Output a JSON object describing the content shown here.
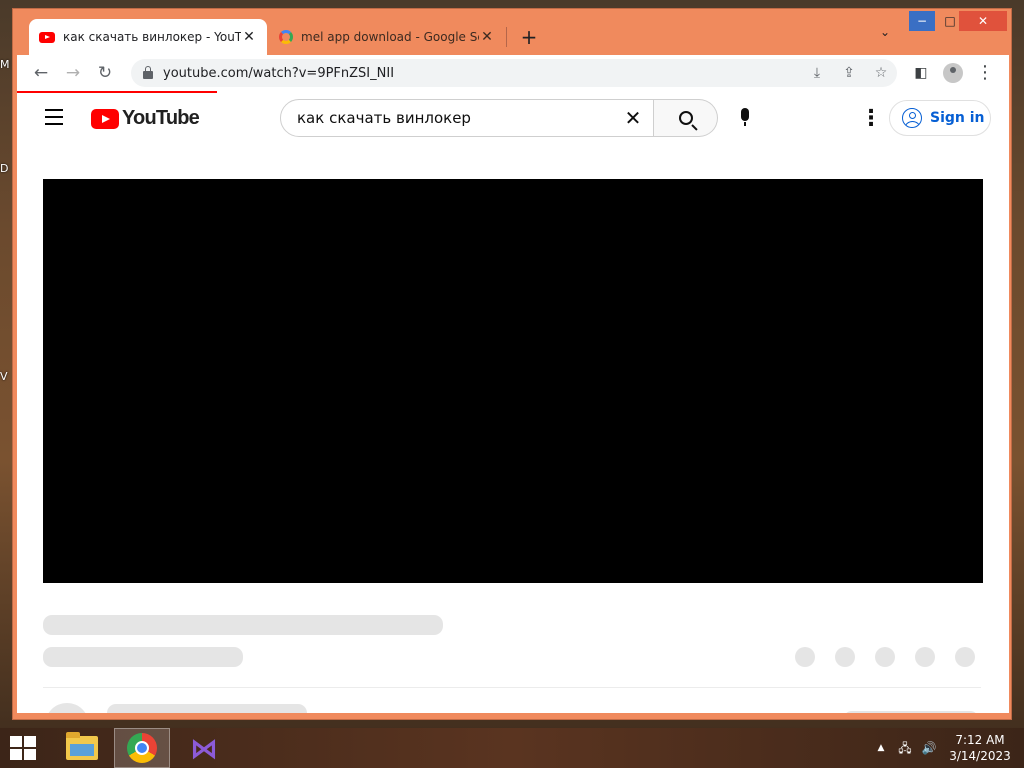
{
  "desktop": {
    "edge_letters": [
      "M",
      "D",
      "V"
    ]
  },
  "browser": {
    "tabs": [
      {
        "title": "как скачать винлокер - YouTube",
        "favicon": "youtube-favicon",
        "active": true
      },
      {
        "title": "mel app download - Google Search",
        "favicon": "google-favicon",
        "active": false
      }
    ],
    "new_tab_label": "+",
    "tab_search_icon": "⌄",
    "window_controls": {
      "minimize": "−",
      "maximize": "□",
      "close": "✕"
    },
    "nav": {
      "back": "←",
      "forward": "→",
      "reload": "↻"
    },
    "address": "youtube.com/watch?v=9PFnZSI_NII",
    "omnibox_icons": {
      "install": "⤓",
      "share": "⇪",
      "bookmark": "☆"
    },
    "sidepanel_icon": "◧",
    "menu_icon": "⋮",
    "accent": "#f08a5d"
  },
  "youtube": {
    "logo_text": "YouTube",
    "search_query": "как скачать винлокер",
    "clear_icon": "✕",
    "more_icon": "⋮",
    "sign_in_label": "Sign in",
    "brand_red": "#ff0000",
    "link_blue": "#065fd4"
  },
  "taskbar": {
    "apps": [
      "file-explorer",
      "google-chrome",
      "visual-studio"
    ],
    "tray_up_icon": "▲",
    "network_icon": "🖧",
    "volume_icon": "🔊",
    "clock_time": "7:12 AM",
    "clock_date": "3/14/2023"
  }
}
